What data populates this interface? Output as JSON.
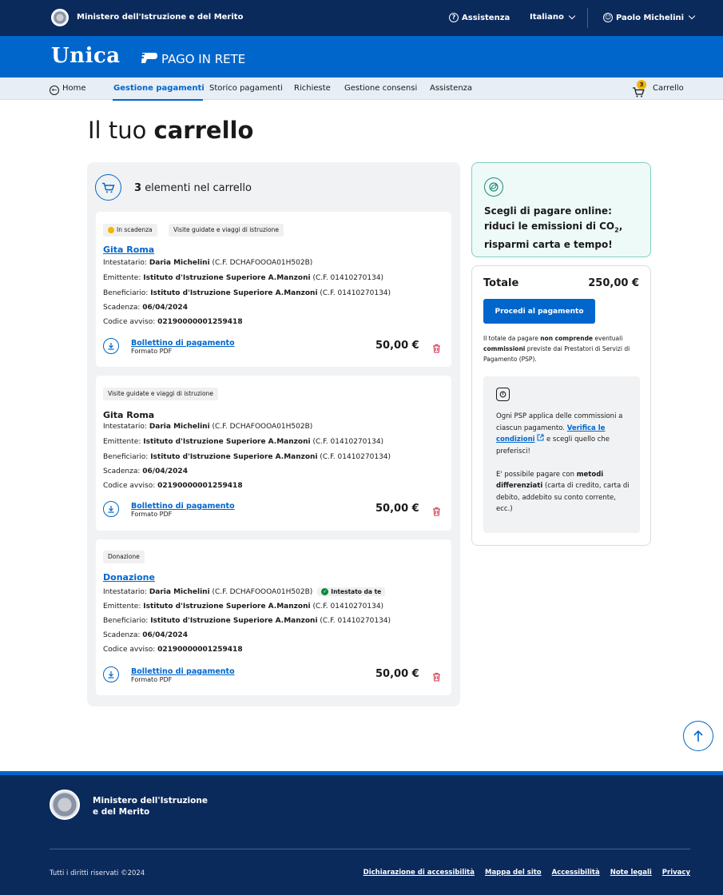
{
  "topbar": {
    "ministry": "Ministero dell'Istruzione e del Merito",
    "assistance": "Assistenza",
    "language": "Italiano",
    "user": "Paolo Michelini"
  },
  "brand": {
    "logo": "Unica",
    "service": "PAGO IN RETE"
  },
  "nav": {
    "items": [
      "Home",
      "Gestione pagamenti",
      "Storico pagamenti",
      "Richieste",
      "Gestione consensi",
      "Assistenza"
    ],
    "active": "Gestione pagamenti",
    "cart_label": "Carrello",
    "cart_badge": "3"
  },
  "page": {
    "title_prefix": "Il tuo",
    "title_bold": "carrello"
  },
  "cart": {
    "count": "3",
    "count_label": "elementi nel carrello",
    "items": [
      {
        "chips": [
          "In scadenza",
          "Visite guidate e viaggi di istruzione"
        ],
        "title": "Gita Roma",
        "intestatario_label": "Intestatario:",
        "intestatario": "Daria Michelini",
        "intestatario_cf": "(C.F. DCHAFOOOA01H502B)",
        "emittente_label": "Emittente:",
        "emittente": "Istituto d'Istruzione Superiore A.Manzoni",
        "emittente_cf": "(C.F. 01410270134)",
        "beneficiario_label": "Beneficiario:",
        "beneficiario": "Istituto d'Istruzione Superiore A.Manzoni",
        "beneficiario_cf": "(C.F. 01410270134)",
        "scadenza_label": "Scadenza:",
        "scadenza": "06/04/2024",
        "codice_label": "Codice avviso:",
        "codice": "02190000001259418",
        "download_label": "Bollettino di pagamento",
        "download_format": "Formato PDF",
        "amount": "50,00 €"
      },
      {
        "chips": [
          "Visite guidate e viaggi di istruzione"
        ],
        "title": "Gita Roma",
        "intestatario_label": "Intestatario:",
        "intestatario": "Daria Michelini",
        "intestatario_cf": "(C.F. DCHAFOOOA01H502B)",
        "emittente_label": "Emittente:",
        "emittente": "Istituto d'Istruzione Superiore A.Manzoni",
        "emittente_cf": "(C.F. 01410270134)",
        "beneficiario_label": "Beneficiario:",
        "beneficiario": "Istituto d'Istruzione Superiore A.Manzoni",
        "beneficiario_cf": "(C.F. 01410270134)",
        "scadenza_label": "Scadenza:",
        "scadenza": "06/04/2024",
        "codice_label": "Codice avviso:",
        "codice": "02190000001259418",
        "download_label": "Bollettino di pagamento",
        "download_format": "Formato PDF",
        "amount": "50,00 €"
      },
      {
        "chips": [
          "Donazione"
        ],
        "title": "Donazione",
        "intestatario_label": "Intestatario:",
        "intestatario": "Daria Michelini",
        "intestatario_cf": "(C.F. DCHAFOOOA01H502B)",
        "intestatario_badge": "Intestato da te",
        "emittente_label": "Emittente:",
        "emittente": "Istituto d'Istruzione Superiore A.Manzoni",
        "emittente_cf": "(C.F. 01410270134)",
        "beneficiario_label": "Beneficiario:",
        "beneficiario": "Istituto d'Istruzione Superiore A.Manzoni",
        "beneficiario_cf": "(C.F. 01410270134)",
        "scadenza_label": "Scadenza:",
        "scadenza": "06/04/2024",
        "codice_label": "Codice avviso:",
        "codice": "02190000001259418",
        "download_label": "Bollettino di pagamento",
        "download_format": "Formato PDF",
        "amount": "50,00 €"
      }
    ]
  },
  "eco": {
    "line1": "Scegli di pagare online:",
    "line2_prefix": "riduci le emissioni di CO",
    "line2_sub": "2",
    "line2_suffix": ",",
    "line3": "risparmi carta e tempo!"
  },
  "summary": {
    "total_label": "Totale",
    "total_value": "250,00 €",
    "pay_button": "Procedi al pagamento",
    "note_a": "Il totale da pagare",
    "note_b": "non comprende",
    "note_c": "eventuali",
    "note_d": "commissioni",
    "note_e": "previste dai Prestatori di Servizi di Pagamento (PSP)."
  },
  "psp": {
    "text_a": "Ogni PSP applica delle commissioni a ciascun pagamento.",
    "link": "Verifica le condizioni",
    "text_b": "e scegli quello che preferisci!",
    "text_c": "E' possibile pagare con",
    "text_d": "metodi differenziati",
    "text_e": "(carta di credito, carta di debito, addebito su conto corrente, ecc.)"
  },
  "footer": {
    "ministry_line1": "Ministero dell'Istruzione",
    "ministry_line2": "e del Merito",
    "rights": "Tutti i diritti riservati ©2024",
    "links": [
      "Dichiarazione di accessibilità",
      "Mappa del sito",
      "Accessibilità",
      "Note legali",
      "Privacy"
    ]
  },
  "colors": {
    "navy": "#0b2a5c",
    "blue": "#0066cc",
    "nav_bg": "#e7eef6",
    "card_bg": "#f1f2f4",
    "eco_bg": "#eefaf8",
    "eco_border": "#7fd1c3",
    "warning": "#f2b600",
    "success": "#0a8a3a",
    "danger": "#d1344c"
  },
  "icons": [
    "emblem-icon",
    "help-icon",
    "chevron-down-icon",
    "user-icon",
    "back-arrow-icon",
    "cart-icon",
    "download-icon",
    "trash-icon",
    "eco-leaf-icon",
    "info-icon",
    "external-link-icon",
    "arrow-up-icon",
    "check-icon"
  ]
}
